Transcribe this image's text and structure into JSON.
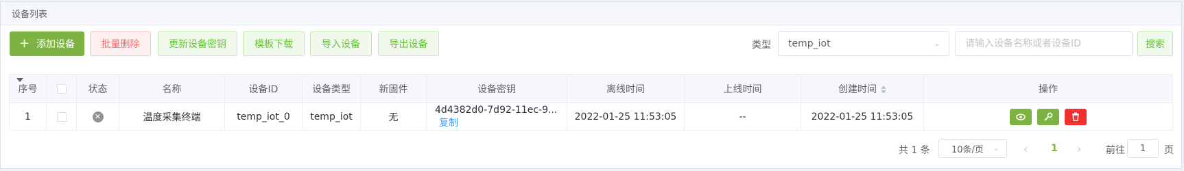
{
  "panel": {
    "title": "设备列表"
  },
  "toolbar": {
    "add_label": "添加设备",
    "batch_delete_label": "批量删除",
    "update_key_label": "更新设备密钥",
    "template_download_label": "模板下载",
    "import_label": "导入设备",
    "export_label": "导出设备"
  },
  "filter": {
    "type_label": "类型",
    "type_value": "temp_iot",
    "search_placeholder": "请输入设备名称或者设备ID",
    "search_button": "搜索"
  },
  "table": {
    "columns": [
      "序号",
      "",
      "状态",
      "名称",
      "设备ID",
      "设备类型",
      "新固件",
      "设备密钥",
      "离线时间",
      "上线时间",
      "创建时间",
      "操作"
    ],
    "rows": [
      {
        "index": "1",
        "status": "offline",
        "name": "温度采集终端",
        "device_id": "temp_iot_0",
        "device_type": "temp_iot",
        "new_firmware": "无",
        "device_key": "4d4382d0-7d92-11ec-9...",
        "copy_label": "复制",
        "offline_time": "2022-01-25 11:53:05",
        "online_time": "--",
        "created_time": "2022-01-25 11:53:05"
      }
    ]
  },
  "pagination": {
    "total_text": "共 1 条",
    "page_size": "10条/页",
    "current_page": "1",
    "goto_label": "前往",
    "goto_value": "1",
    "page_suffix": "页"
  },
  "colors": {
    "primary_green": "#7cb342",
    "danger_red": "#f23030",
    "link_blue": "#409eff"
  }
}
